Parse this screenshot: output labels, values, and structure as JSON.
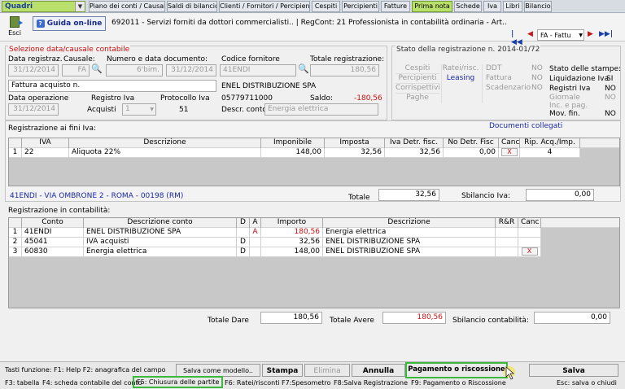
{
  "topbar": {
    "combo": "Quadri",
    "tabs": [
      "Piano dei conti / Causali",
      "Saldi di bilancio",
      "Clienti / Fornitori / Percipienti",
      "Cespiti",
      "Percipienti",
      "Fatture",
      "Prima nota",
      "Schede",
      "Iva",
      "Libri",
      "Bilancio"
    ],
    "active_tab": "Prima nota"
  },
  "toolbar": {
    "esci": "Esci",
    "guida": "Guida on-line",
    "description": "692011 - Servizi forniti da dottori commercialisti.. | RegCont: 21 Professionista in contabilità ordinaria - Art..",
    "nav_select": "FA - Fattu"
  },
  "selezione": {
    "title": "Selezione data/causale contabile",
    "data_reg_label": "Data registraz.",
    "data_reg": "31/12/2014",
    "causale_label": "Causale:",
    "causale": "FA",
    "numdoc_label": "Numero e data documento:",
    "numdoc": "6'bim.",
    "datadoc": "31/12/2014",
    "causale_desc": "Fattura acquisto n.",
    "data_op_label": "Data operazione",
    "data_op": "31/12/2014",
    "registro_label": "Registro Iva",
    "registro": "Acquisti",
    "registro_num": "1",
    "protocollo_label": "Protocollo Iva",
    "protocollo": "51"
  },
  "fornitore": {
    "codice_label": "Codice fornitore",
    "codice": "41ENDI",
    "totale_label": "Totale registrazione:",
    "totale": "180,56",
    "nome": "ENEL DISTRIBUZIONE SPA",
    "piva": "05779711000",
    "saldo_label": "Saldo:",
    "saldo": "-180,56",
    "descr_label": "Descr. conto",
    "descr": "Energia elettrica"
  },
  "stato": {
    "title": "Stato della registrazione n. 2014-01/72",
    "col1": [
      "Cespiti",
      "Percipienti",
      "Corrispettivi",
      "Paghe"
    ],
    "col2": [
      "Ratei/risc.",
      "Leasing"
    ],
    "col3": [
      "DDT",
      "Fattura",
      "Scadenzario"
    ],
    "col3vals": [
      "NO",
      "NO",
      "NO"
    ],
    "stampe_title": "Stato delle stampe:",
    "stampe": [
      {
        "k": "Liquidazione Iva",
        "v": "SI"
      },
      {
        "k": "Registri Iva",
        "v": "NO"
      },
      {
        "k": "Giornale",
        "v": "NO"
      },
      {
        "k": "Inc. e pag.",
        "v": ""
      },
      {
        "k": "Mov. fin.",
        "v": "NO"
      }
    ]
  },
  "iva": {
    "title": "Registrazione ai fini Iva:",
    "link": "Documenti collegati",
    "headers": [
      "IVA",
      "Descrizione",
      "Imponibile",
      "Imposta",
      "Iva Detr. fisc.",
      "No Detr. Fisc",
      "Canc",
      "Rip. Acq./Imp."
    ],
    "rows": [
      {
        "n": "1",
        "iva": "22",
        "desc": "Aliquota 22%",
        "imp": "148,00",
        "imposta": "32,56",
        "detr": "32,56",
        "nodetr": "0,00",
        "canc": "X",
        "rip": "4"
      }
    ],
    "indirizzo": "41ENDI - VIA OMBRONE 2 - ROMA - 00198 (RM)",
    "totale_label": "Totale",
    "totale": "32,56",
    "sbil_label": "Sbilancio Iva:",
    "sbil": "0,00"
  },
  "contab": {
    "title": "Registrazione in contabilità:",
    "headers": [
      "Conto",
      "Descrizione conto",
      "D",
      "A",
      "Importo",
      "Descrizione",
      "R&R",
      "Canc"
    ],
    "rows": [
      {
        "n": "1",
        "conto": "41ENDI",
        "desc": "ENEL DISTRIBUZIONE SPA",
        "d": "",
        "a": "A",
        "imp": "180,56",
        "descr": "Energia elettrica",
        "canc": ""
      },
      {
        "n": "2",
        "conto": "45041",
        "desc": "IVA acquisti",
        "d": "D",
        "a": "",
        "imp": "32,56",
        "descr": "ENEL DISTRIBUZIONE SPA",
        "canc": ""
      },
      {
        "n": "3",
        "conto": "60830",
        "desc": "Energia elettrica",
        "d": "D",
        "a": "",
        "imp": "148,00",
        "descr": "ENEL DISTRIBUZIONE SPA",
        "canc": "X"
      }
    ],
    "dare_label": "Totale Dare",
    "dare": "180,56",
    "avere_label": "Totale Avere",
    "avere": "180,56",
    "sbil_label": "Sbilancio contabilità:",
    "sbil": "0,00"
  },
  "footer": {
    "tasti": "Tasti funzione:  F1: Help  F2: anagrafica del campo",
    "salva_modello": "Salva come modello..",
    "stampa": "Stampa",
    "elimina": "Elimina",
    "annulla": "Annulla",
    "pagamento": "Pagamento o riscossione",
    "salva": "Salva",
    "f3": "F3: tabella",
    "f4": "F4: scheda contabile del conto",
    "f5": "F5: Chiusura delle partite",
    "f6": "F6: Ratei/risconti",
    "f7": "F7:Spesometro",
    "f8": "F8:Salva Registrazione",
    "f9": "F9: Pagamento o Riscossione",
    "esc": "Esc: salva o chiudi"
  }
}
